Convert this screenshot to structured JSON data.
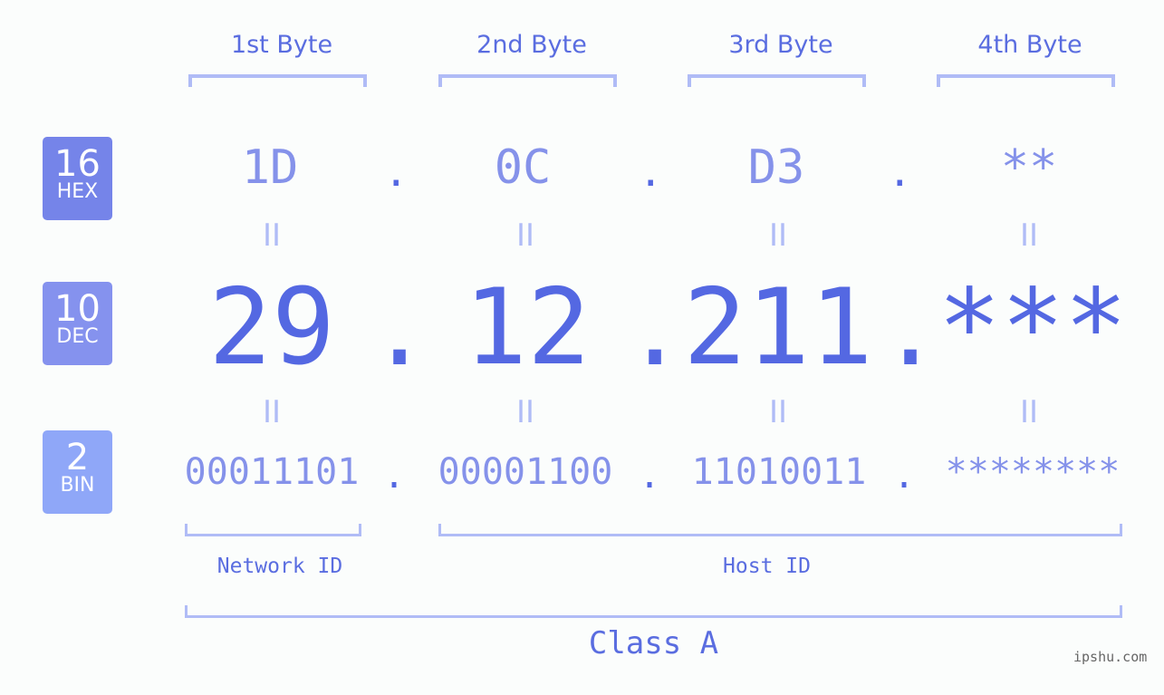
{
  "badges": [
    {
      "num": "16",
      "label": "HEX",
      "color": "#7584e9"
    },
    {
      "num": "10",
      "label": "DEC",
      "color": "#8592ee"
    },
    {
      "num": "2",
      "label": "BIN",
      "color": "#8fa7f8"
    }
  ],
  "bytes": [
    {
      "header": "1st Byte",
      "hex": "1D",
      "dec": "29",
      "bin": "00011101"
    },
    {
      "header": "2nd Byte",
      "hex": "0C",
      "dec": "12",
      "bin": "00001100"
    },
    {
      "header": "3rd Byte",
      "hex": "D3",
      "dec": "211",
      "bin": "11010011"
    },
    {
      "header": "4th Byte",
      "hex": "**",
      "dec": "***",
      "bin": "********"
    }
  ],
  "separator": ".",
  "equals": "II",
  "network_label": "Network ID",
  "host_label": "Host ID",
  "class_label": "Class A",
  "watermark": "ipshu.com"
}
